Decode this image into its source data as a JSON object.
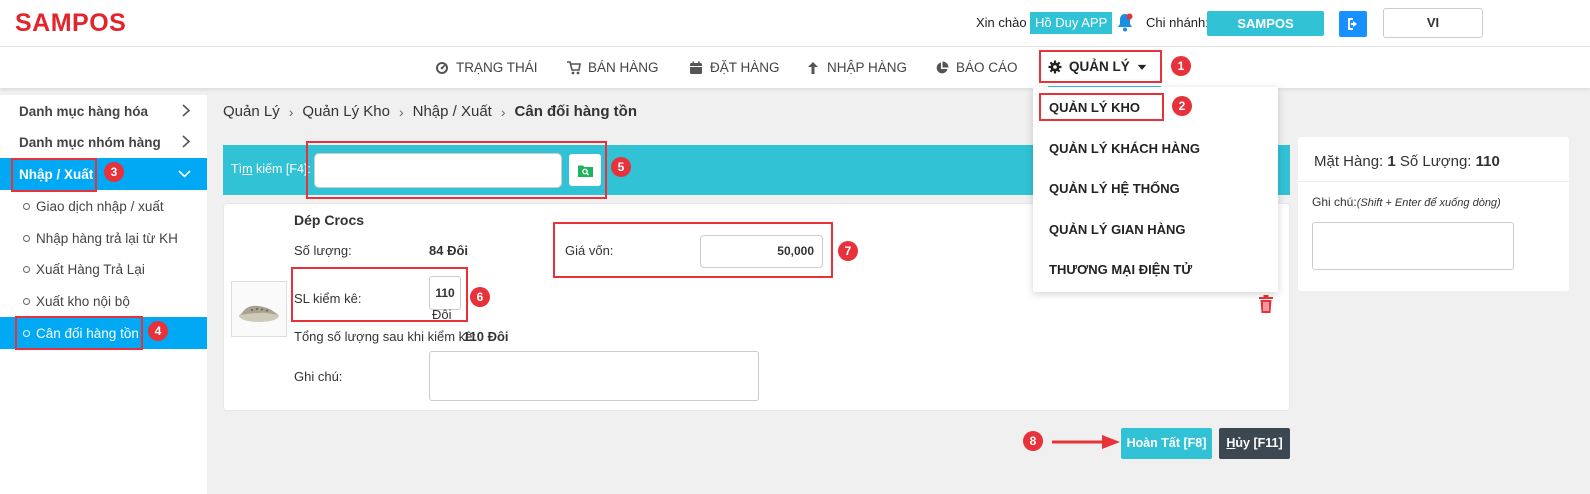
{
  "header": {
    "logo": "SAMPOS",
    "greeting": "Xin chào",
    "user": "Hồ Duy APP",
    "branch_label": "Chi nhánh:",
    "branch": "SAMPOS",
    "language": "VI"
  },
  "nav": {
    "items": [
      {
        "label": "TRẠNG THÁI",
        "icon": "dashboard-icon"
      },
      {
        "label": "BÁN HÀNG",
        "icon": "cart-icon"
      },
      {
        "label": "ĐẶT HÀNG",
        "icon": "calendar-icon"
      },
      {
        "label": "NHẬP HÀNG",
        "icon": "arrow-up-icon"
      },
      {
        "label": "BÁO CÁO",
        "icon": "pie-chart-icon"
      },
      {
        "label": "QUẢN LÝ",
        "icon": "gear-icon"
      }
    ]
  },
  "dropdown": {
    "items": [
      "QUẢN LÝ KHO",
      "QUẢN LÝ KHÁCH HÀNG",
      "QUẢN LÝ HỆ THỐNG",
      "QUẢN LÝ GIAN HÀNG",
      "THƯƠNG MẠI ĐIỆN TỬ"
    ]
  },
  "sidebar": {
    "items": [
      {
        "label": "Danh mục hàng hóa"
      },
      {
        "label": "Danh mục nhóm hàng"
      },
      {
        "label": "Nhập / Xuất"
      }
    ],
    "subitems": [
      {
        "label": "Giao dịch nhập / xuất"
      },
      {
        "label": "Nhập hàng trả lại từ KH"
      },
      {
        "label": "Xuất Hàng Trả Lại"
      },
      {
        "label": "Xuất kho nội bộ"
      },
      {
        "label": "Cân đối hàng tồn"
      }
    ]
  },
  "breadcrumb": {
    "items": [
      "Quản Lý",
      "Quản Lý Kho",
      "Nhập / Xuất"
    ],
    "current": "Cân đối hàng tồn"
  },
  "search": {
    "label_pre": "Tì",
    "label_u": "m",
    "label_post": " kiếm [F4]:",
    "value": ""
  },
  "product": {
    "name": "Dép Crocs",
    "qty_label": "Số lượng:",
    "qty_value": "84 Đôi",
    "price_label": "Giá vốn:",
    "price_value": "50,000",
    "count_label": "SL kiểm kê:",
    "count_value": "110",
    "count_unit": "Đôi",
    "total_label": "Tổng số lượng sau khi kiểm kê:",
    "total_value": "110 Đôi",
    "note_label": "Ghi chú:"
  },
  "summary": {
    "items_label": "Mặt Hàng:",
    "items_value": "1",
    "qty_label": "Số Lượng:",
    "qty_value": "110",
    "note_label": "Ghi chú:",
    "note_hint": "(Shift + Enter để xuống dòng)"
  },
  "actions": {
    "done": "Hoàn Tất [F8]",
    "cancel_u": "H",
    "cancel_rest": "ủy [F11]"
  },
  "annotations": [
    "1",
    "2",
    "3",
    "4",
    "5",
    "6",
    "7",
    "8"
  ],
  "colors": {
    "brand": "#e2242c",
    "accent": "#31c2d6",
    "sidebar_active": "#01a9f4",
    "highlight": "#e8323b"
  }
}
